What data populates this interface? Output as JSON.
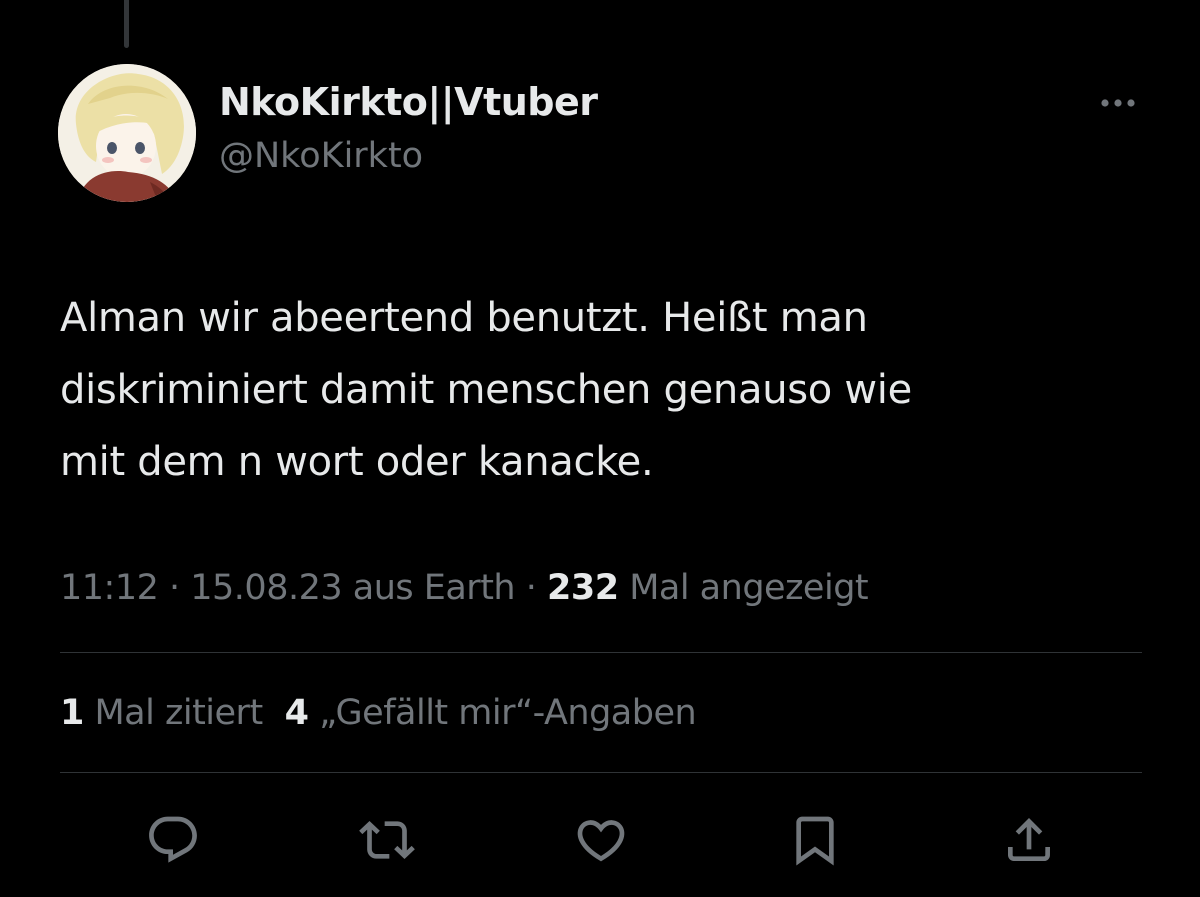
{
  "user": {
    "display_name": "NkoKirkto||Vtuber",
    "handle": "@NkoKirkto",
    "avatar_icon": "avatar-image"
  },
  "tweet": {
    "lines": [
      "Alman wir abeertend benutzt. Heißt man",
      "diskriminiert damit menschen genauso wie",
      "mit dem n wort oder kanacke."
    ]
  },
  "meta": {
    "time": "11:12",
    "sep1": " · ",
    "date_source": "15.08.23 aus Earth",
    "sep2": " · ",
    "views_count": "232",
    "views_label": " Mal angezeigt"
  },
  "stats": {
    "quotes_count": "1",
    "quotes_label": " Mal zitiert",
    "likes_count": "4",
    "likes_label": " „Gefällt mir“-Angaben"
  },
  "actions": {
    "reply": "reply-icon",
    "retweet": "retweet-icon",
    "like": "heart-icon",
    "bookmark": "bookmark-icon",
    "share": "share-icon"
  },
  "colors": {
    "background": "#000000",
    "text_primary": "#e7e9ea",
    "text_secondary": "#71767b",
    "divider": "#2f3336"
  }
}
